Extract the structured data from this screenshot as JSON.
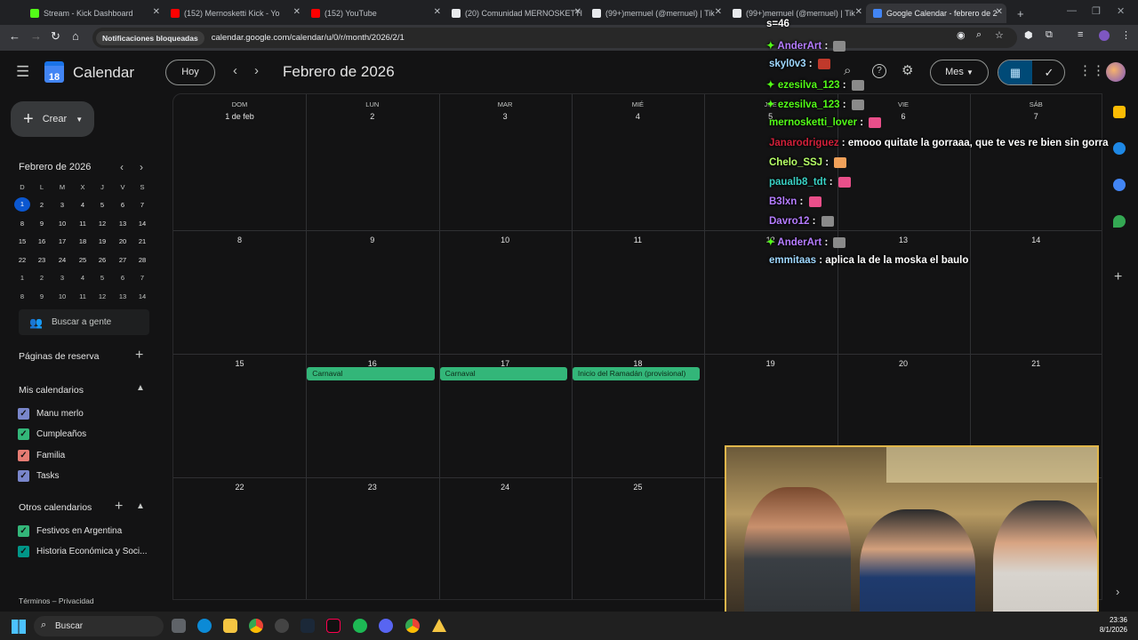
{
  "browser": {
    "tabs": [
      {
        "title": "Stream - Kick Dashboard",
        "color": "#53fc18"
      },
      {
        "title": "(152) Mernosketti Kick - Yo",
        "color": "#ff0000"
      },
      {
        "title": "(152) YouTube",
        "color": "#ff0000"
      },
      {
        "title": "(20) Comunidad MERNOSKETTI",
        "color": "#e8eaed"
      },
      {
        "title": "(99+)mernuel (@mernuel) | Tik",
        "color": "#e8eaed"
      },
      {
        "title": "(99+)mernuel (@mernuel) | Tik",
        "color": "#e8eaed"
      },
      {
        "title": "Google Calendar - febrero de 2",
        "color": "#4285f4"
      }
    ],
    "notif_chip": "Notificaciones bloqueadas",
    "url": "calendar.google.com/calendar/u/0/r/month/2026/2/1"
  },
  "header": {
    "app_name": "Calendar",
    "logo_day": "18",
    "today_button": "Hoy",
    "month_title": "Febrero de 2026",
    "view_select": "Mes"
  },
  "sidebar": {
    "create_label": "Crear",
    "mini_title": "Febrero de 2026",
    "mini_days": [
      "D",
      "L",
      "M",
      "X",
      "J",
      "V",
      "S"
    ],
    "mini_weeks": [
      [
        "1",
        "2",
        "3",
        "4",
        "5",
        "6",
        "7"
      ],
      [
        "8",
        "9",
        "10",
        "11",
        "12",
        "13",
        "14"
      ],
      [
        "15",
        "16",
        "17",
        "18",
        "19",
        "20",
        "21"
      ],
      [
        "22",
        "23",
        "24",
        "25",
        "26",
        "27",
        "28"
      ],
      [
        "1",
        "2",
        "3",
        "4",
        "5",
        "6",
        "7"
      ],
      [
        "8",
        "9",
        "10",
        "11",
        "12",
        "13",
        "14"
      ]
    ],
    "search_people": "Buscar a gente",
    "booking_pages": "Páginas de reserva",
    "my_calendars_title": "Mis calendarios",
    "my_calendars": [
      {
        "name": "Manu merlo",
        "color": "#7986cb"
      },
      {
        "name": "Cumpleaños",
        "color": "#33b679"
      },
      {
        "name": "Familia",
        "color": "#e67c73"
      },
      {
        "name": "Tasks",
        "color": "#7986cb"
      }
    ],
    "other_calendars_title": "Otros calendarios",
    "other_calendars": [
      {
        "name": "Festivos en Argentina",
        "color": "#33b679"
      },
      {
        "name": "Historia Económica y Soci...",
        "color": "#009688"
      }
    ],
    "footer": "Términos – Privacidad"
  },
  "grid": {
    "dow": [
      "DOM",
      "LUN",
      "MAR",
      "MIÉ",
      "JUE",
      "VIE",
      "SÁB"
    ],
    "weeks": [
      [
        "1 de feb",
        "2",
        "3",
        "4",
        "5",
        "6",
        "7"
      ],
      [
        "8",
        "9",
        "10",
        "11",
        "12",
        "13",
        "14"
      ],
      [
        "15",
        "16",
        "17",
        "18",
        "19",
        "20",
        "21"
      ],
      [
        "22",
        "23",
        "24",
        "25",
        "",
        "",
        ""
      ]
    ],
    "events": [
      {
        "title": "Carnaval",
        "week": 2,
        "day": 1
      },
      {
        "title": "Carnaval",
        "week": 2,
        "day": 2
      },
      {
        "title": "Inicio del Ramadán (provisional)",
        "week": 2,
        "day": 3
      }
    ]
  },
  "chat": {
    "header": "s=46",
    "messages": [
      {
        "user": "AnderArt",
        "badge": true,
        "color": "#b57cff",
        "text": "",
        "emote": "#8a8a8a"
      },
      {
        "user": "skyl0v3",
        "badge": false,
        "color": "#9fd8ff",
        "text": "",
        "emote": "#c0392b"
      },
      {
        "user": "ezesilva_123",
        "badge": true,
        "color": "#53fc18",
        "text": "",
        "emote": "#8a8a8a"
      },
      {
        "user": "ezesilva_123",
        "badge": true,
        "color": "#53fc18",
        "text": "",
        "emote": "#8a8a8a"
      },
      {
        "user": "mernosketti_lover",
        "badge": false,
        "color": "#53fc18",
        "text": "",
        "emote": "#e94f8a"
      },
      {
        "user": "Janarodriguez",
        "badge": false,
        "color": "#d1203a",
        "text": "emooo quitate la gorraaa, que te ves re bien sin gorra",
        "emote": ""
      },
      {
        "user": "Chelo_SSJ",
        "badge": false,
        "color": "#b6ff66",
        "text": "",
        "emote": "#f1a15a"
      },
      {
        "user": "paualb8_tdt",
        "badge": false,
        "color": "#39d0c3",
        "text": "",
        "emote": "#e94f8a"
      },
      {
        "user": "B3lxn",
        "badge": false,
        "color": "#b57cff",
        "text": "",
        "emote": "#e94f8a"
      },
      {
        "user": "Davro12",
        "badge": false,
        "color": "#b57cff",
        "text": "",
        "emote": "#8a8a8a"
      },
      {
        "user": "AnderArt",
        "badge": true,
        "color": "#b57cff",
        "text": "",
        "emote": "#8a8a8a"
      },
      {
        "user": "emmitaas",
        "badge": false,
        "color": "#9fd8ff",
        "text": "aplica la de la moska el baulo",
        "emote": ""
      }
    ]
  },
  "taskbar": {
    "search": "Buscar",
    "time": "23:36",
    "date": "8/1/2026"
  }
}
